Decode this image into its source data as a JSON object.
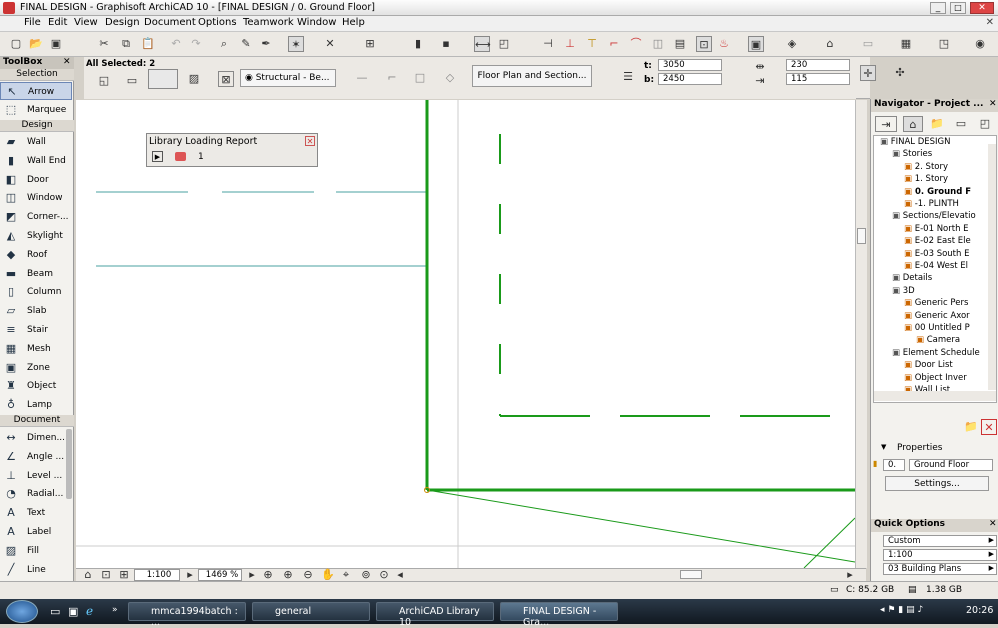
{
  "window": {
    "title": "FINAL DESIGN - Graphisoft ArchiCAD 10 - [FINAL DESIGN / 0. Ground Floor]"
  },
  "menu": [
    "File",
    "Edit",
    "View",
    "Design",
    "Document",
    "Options",
    "Teamwork",
    "Window",
    "Help"
  ],
  "toolbox": {
    "title": "ToolBox",
    "selection": "Selection",
    "tools_sel": [
      "Arrow",
      "Marquee"
    ],
    "design": "Design",
    "tools_design": [
      "Wall",
      "Wall End",
      "Door",
      "Window",
      "Corner-...",
      "Skylight",
      "Roof",
      "Beam",
      "Column",
      "Slab",
      "Stair",
      "Mesh",
      "Zone",
      "Object",
      "Lamp"
    ],
    "document": "Document",
    "tools_doc": [
      "Dimen...",
      "Angle ...",
      "Level ...",
      "Radial...",
      "Text",
      "Label",
      "Fill",
      "Line"
    ]
  },
  "infobox": {
    "selected": "All Selected: 2",
    "structural": "Structural - Be...",
    "floorplan_btn": "Floor Plan and Section...",
    "t_label": "t:",
    "t_value": "3050",
    "b_label": "b:",
    "b_value": "2450",
    "v1": "230",
    "v2": "115"
  },
  "library_report": {
    "title": "Library Loading Report",
    "count": "1"
  },
  "bottombar": {
    "scale": "1:100",
    "zoom": "1469 %"
  },
  "navigator": {
    "title": "Navigator - Project ...",
    "tree": [
      "FINAL DESIGN",
      "Stories",
      "2. Story",
      "1. Story",
      "0. Ground F",
      "-1. PLINTH",
      "Sections/Elevatio",
      "E-01 North E",
      "E-02 East Ele",
      "E-03 South E",
      "E-04 West El",
      "Details",
      "3D",
      "Generic Pers",
      "Generic Axor",
      "00 Untitled P",
      "Camera",
      "Element Schedule",
      "Door List",
      "Object Inver",
      "Wall List"
    ]
  },
  "properties": {
    "title": "Properties",
    "num": "0.",
    "value": "Ground Floor",
    "settings": "Settings..."
  },
  "quick_options": {
    "title": "Quick Options",
    "items": [
      "Custom",
      "1:100",
      "03 Building Plans"
    ]
  },
  "statusbar": {
    "disk": "C: 85.2 GB",
    "mem": "1.38 GB"
  },
  "taskbar": {
    "tasks": [
      "mmca1994batch : ...",
      "general",
      "ArchiCAD Library 10",
      "FINAL DESIGN - Gra..."
    ],
    "time": "20:26"
  },
  "colors": {
    "wall": "#1a9a1a",
    "guide": "#4aa0a0",
    "taskbar": "#1a2530"
  }
}
